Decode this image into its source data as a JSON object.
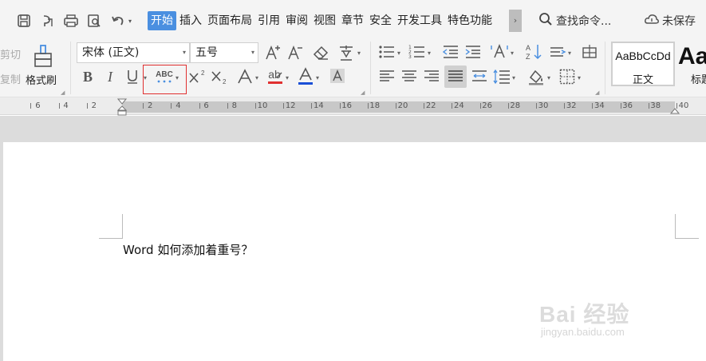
{
  "menu": {
    "tabs": [
      "开始",
      "插入",
      "页面布局",
      "引用",
      "审阅",
      "视图",
      "章节",
      "安全",
      "开发工具",
      "特色功能"
    ],
    "active_tab": "开始",
    "more_label": "›",
    "search_label": "查找命令...",
    "save_status": "未保存"
  },
  "ribbon": {
    "cut_label": "剪切",
    "copy_label": "复制",
    "format_painter_label": "格式刷",
    "font_name": "宋体 (正文)",
    "font_size": "五号",
    "styles": [
      {
        "sample": "AaBbCcDd",
        "name": "正文"
      },
      {
        "sample": "Aa",
        "name": "标题"
      }
    ]
  },
  "ruler": {
    "left_ticks": [
      "6",
      "4",
      "2"
    ],
    "right_ticks": [
      "2",
      "4",
      "6",
      "8",
      "10",
      "12",
      "14",
      "16",
      "18",
      "20",
      "22",
      "24",
      "26",
      "28",
      "30",
      "32",
      "34",
      "36",
      "38",
      "40"
    ]
  },
  "document": {
    "text": "Word 如何添加着重号？"
  },
  "watermark": {
    "main": "Bai 经验",
    "sub": "jingyan.baidu.com"
  },
  "colors": {
    "accent": "#4a8fe0",
    "highlight_border": "#e03030",
    "font_color_bar": "#1a4fd6"
  }
}
